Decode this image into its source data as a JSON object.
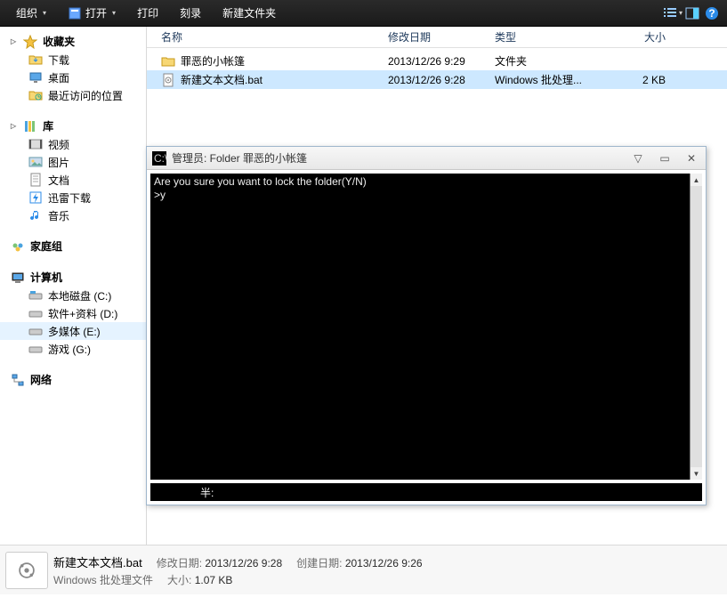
{
  "toolbar": {
    "organize": "组织",
    "open": "打开",
    "print": "打印",
    "burn": "刻录",
    "newfolder": "新建文件夹"
  },
  "sidebar": {
    "favorites": {
      "label": "收藏夹",
      "items": [
        "下载",
        "桌面",
        "最近访问的位置"
      ]
    },
    "libraries": {
      "label": "库",
      "items": [
        "视频",
        "图片",
        "文档",
        "迅雷下载",
        "音乐"
      ]
    },
    "homegroup": {
      "label": "家庭组"
    },
    "computer": {
      "label": "计算机",
      "items": [
        "本地磁盘 (C:)",
        "软件+资料 (D:)",
        "多媒体 (E:)",
        "游戏 (G:)"
      ],
      "selected": 2
    },
    "network": {
      "label": "网络"
    }
  },
  "columns": {
    "name": "名称",
    "date": "修改日期",
    "type": "类型",
    "size": "大小"
  },
  "rows": [
    {
      "name": "罪恶的小帐篷",
      "date": "2013/12/26 9:29",
      "type": "文件夹",
      "size": "",
      "icon": "folder",
      "selected": false
    },
    {
      "name": "新建文本文档.bat",
      "date": "2013/12/26 9:28",
      "type": "Windows 批处理...",
      "size": "2 KB",
      "icon": "bat",
      "selected": true
    }
  ],
  "details": {
    "filename": "新建文本文档.bat",
    "filetype": "Windows 批处理文件",
    "mod_label": "修改日期:",
    "mod_value": "2013/12/26 9:28",
    "create_label": "创建日期:",
    "create_value": "2013/12/26 9:26",
    "size_label": "大小:",
    "size_value": "1.07 KB"
  },
  "cmd": {
    "title": "管理员: Folder 罪恶的小帐篷",
    "line1": "Are you sure you want to lock the folder(Y/N)",
    "line2": ">y",
    "footer": "半:"
  }
}
